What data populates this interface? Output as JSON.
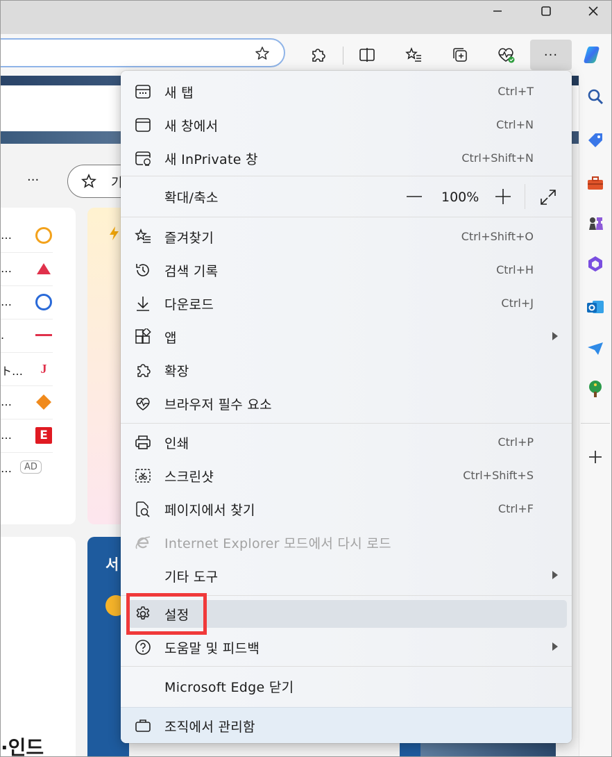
{
  "window": {
    "controls": {
      "minimize": "minimize",
      "maximize": "maximize",
      "close": "close"
    }
  },
  "toolbar": {
    "more_label": "···"
  },
  "page": {
    "nav_more": "···",
    "chip_partial": "기",
    "ad_badge": "AD",
    "list_rows": [
      "…",
      "…",
      "…",
      ".",
      "ト…",
      "…",
      "…",
      "…"
    ],
    "weather_partial": "서",
    "bottom_partial": "·인드"
  },
  "menu": {
    "items": [
      {
        "label": "새 탭",
        "shortcut": "Ctrl+T",
        "icon": "new-tab-icon"
      },
      {
        "label": "새 창에서",
        "shortcut": "Ctrl+N",
        "icon": "new-window-icon"
      },
      {
        "label": "새 InPrivate 창",
        "shortcut": "Ctrl+Shift+N",
        "icon": "inprivate-icon"
      },
      {
        "label": "확대/축소",
        "zoom": "100%",
        "zoom_minus": "—",
        "zoom_plus": "+"
      },
      {
        "label": "즐겨찾기",
        "shortcut": "Ctrl+Shift+O",
        "icon": "favorites-icon"
      },
      {
        "label": "검색 기록",
        "shortcut": "Ctrl+H",
        "icon": "history-icon"
      },
      {
        "label": "다운로드",
        "shortcut": "Ctrl+J",
        "icon": "download-icon"
      },
      {
        "label": "앱",
        "icon": "apps-icon"
      },
      {
        "label": "확장",
        "icon": "extensions-icon"
      },
      {
        "label": "브라우저 필수 요소",
        "icon": "heartbeat-icon"
      },
      {
        "label": "인쇄",
        "shortcut": "Ctrl+P",
        "icon": "print-icon"
      },
      {
        "label": "스크린샷",
        "shortcut": "Ctrl+Shift+S",
        "icon": "screenshot-icon"
      },
      {
        "label": "페이지에서 찾기",
        "shortcut": "Ctrl+F",
        "icon": "find-icon"
      },
      {
        "label": "Internet Explorer 모드에서 다시 로드",
        "icon": "ie-icon",
        "disabled": true
      },
      {
        "label": "기타 도구"
      },
      {
        "label": "설정",
        "icon": "gear-icon",
        "highlighted": true
      },
      {
        "label": "도움말 및 피드백",
        "icon": "help-icon"
      },
      {
        "label": "Microsoft Edge 닫기"
      },
      {
        "label": "조직에서 관리함",
        "icon": "briefcase-icon"
      }
    ]
  },
  "colors": {
    "highlight_border": "#f0393a",
    "menu_hover": "#dce1e7",
    "address_border": "#8fb4e8"
  }
}
